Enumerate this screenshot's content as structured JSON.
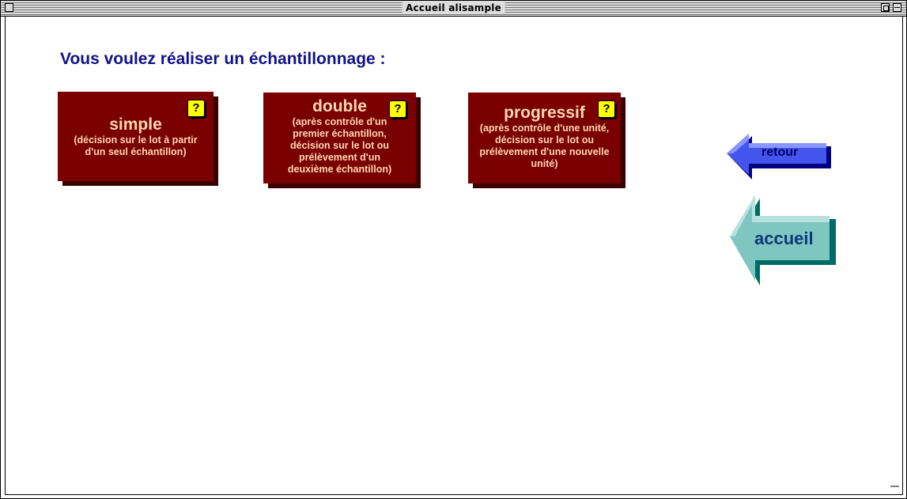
{
  "window": {
    "title": "Accueil alisample"
  },
  "page": {
    "heading": "Vous voulez réaliser un échantillonnage :"
  },
  "cards": [
    {
      "title": "simple",
      "subtitle": "(décision sur le lot à partir d'un seul échantillon)",
      "help": "?"
    },
    {
      "title": "double",
      "subtitle": "(après contrôle d'un premier échantillon, décision sur le lot ou prélèvement d'un deuxième échantillon)",
      "help": "?"
    },
    {
      "title": "progressif",
      "subtitle": "(après contrôle d'une unité, décision sur le lot ou prélèvement d'une nouvelle unité)",
      "help": "?"
    }
  ],
  "nav": {
    "retour_label": "retour",
    "accueil_label": "accueil"
  },
  "colors": {
    "heading": "#101288",
    "card_bg": "#7a0000",
    "card_text": "#ffd7b3",
    "retour_arrow": "#5566ff",
    "accueil_arrow": "#7fc8c4"
  }
}
